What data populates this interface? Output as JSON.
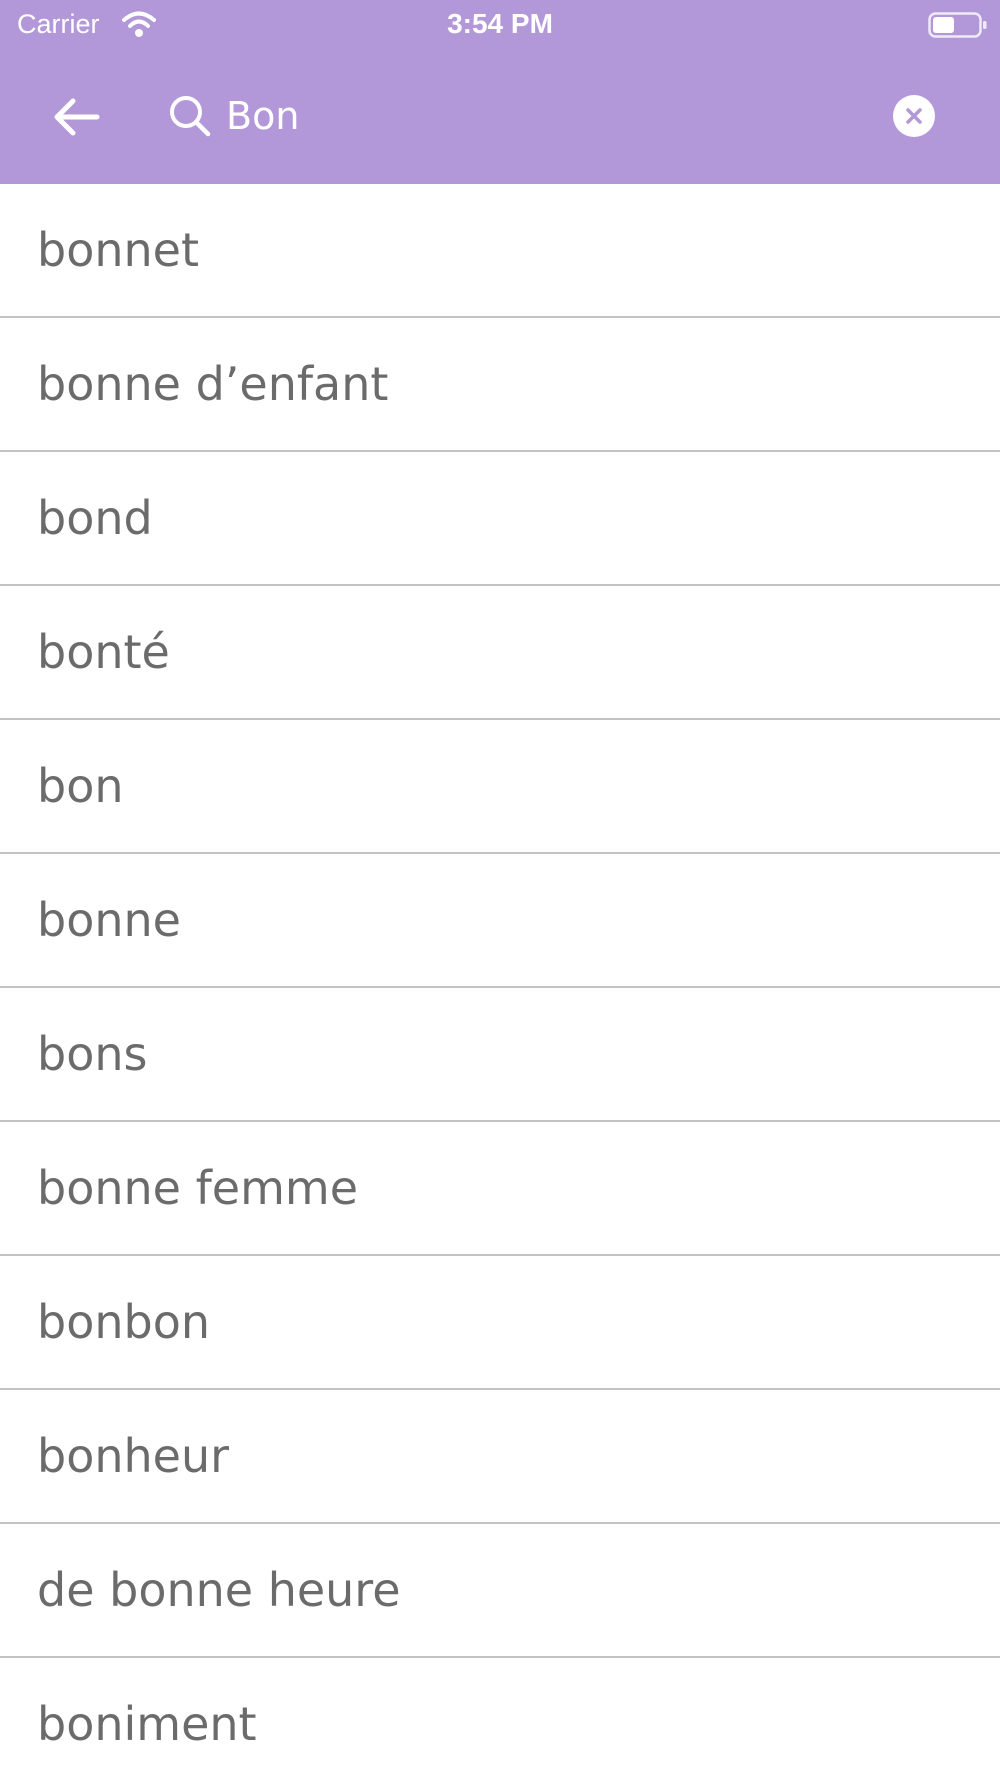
{
  "status_bar": {
    "carrier": "Carrier",
    "time": "3:54 PM",
    "icons": [
      "wifi-icon",
      "battery-icon"
    ]
  },
  "search": {
    "query": "Bon",
    "icons": [
      "back-arrow-icon",
      "search-icon",
      "clear-icon"
    ]
  },
  "colors": {
    "header_bg": "#b398d9",
    "text_gray": "#6b6b6b",
    "divider": "#c3c3c3"
  },
  "results": [
    "bonnet",
    "bonne d’enfant",
    "bond",
    "bonté",
    "bon",
    "bonne",
    "bons",
    "bonne femme",
    "bonbon",
    "bonheur",
    "de bonne heure",
    "boniment"
  ]
}
